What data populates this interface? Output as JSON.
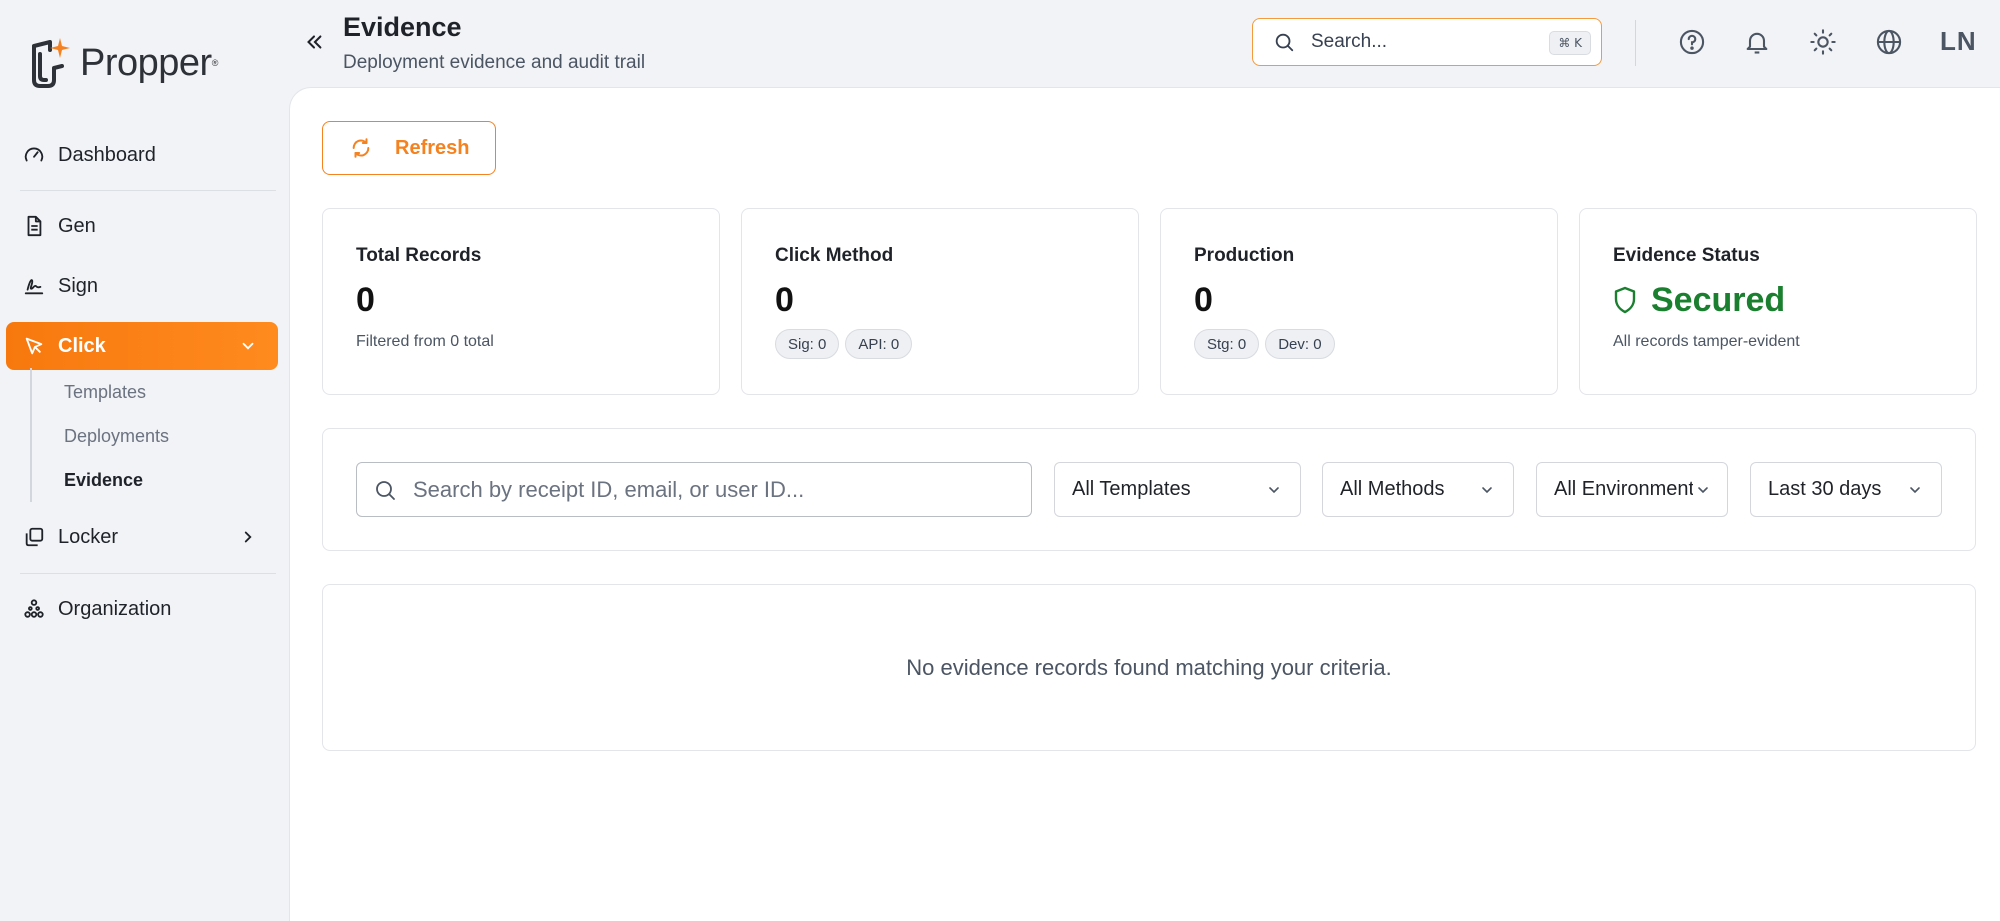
{
  "brand": {
    "name": "Propper",
    "tm": "®",
    "accent": "#f58220",
    "accent_gradient_end": "#ff8a1e",
    "success": "#1a7f2e"
  },
  "sidebar": {
    "items": [
      {
        "label": "Dashboard",
        "icon": "gauge-icon"
      },
      {
        "label": "Gen",
        "icon": "document-icon"
      },
      {
        "label": "Sign",
        "icon": "signature-icon"
      },
      {
        "label": "Click",
        "icon": "cursor-click-icon",
        "active": true,
        "expanded": true
      },
      {
        "label": "Locker",
        "icon": "copy-stack-icon"
      },
      {
        "label": "Organization",
        "icon": "org-nodes-icon"
      }
    ],
    "click_subitems": [
      {
        "label": "Templates"
      },
      {
        "label": "Deployments"
      },
      {
        "label": "Evidence",
        "current": true
      }
    ]
  },
  "header": {
    "title": "Evidence",
    "subtitle": "Deployment evidence and audit trail",
    "search_placeholder": "Search...",
    "search_shortcut": "⌘ K",
    "user_initials": "LN"
  },
  "toolbar": {
    "refresh_label": "Refresh"
  },
  "stats": {
    "total": {
      "label": "Total Records",
      "value": "0",
      "note": "Filtered from 0 total"
    },
    "click_method": {
      "label": "Click Method",
      "value": "0",
      "sig": "Sig: 0",
      "api": "API: 0"
    },
    "production": {
      "label": "Production",
      "value": "0",
      "stg": "Stg: 0",
      "dev": "Dev: 0"
    },
    "evidence_status": {
      "label": "Evidence Status",
      "value": "Secured",
      "note": "All records tamper-evident"
    }
  },
  "filters": {
    "search_placeholder": "Search by receipt ID, email, or user ID...",
    "template": "All Templates",
    "method": "All Methods",
    "environment": "All Environments",
    "range": "Last 30 days"
  },
  "empty_message": "No evidence records found matching your criteria."
}
